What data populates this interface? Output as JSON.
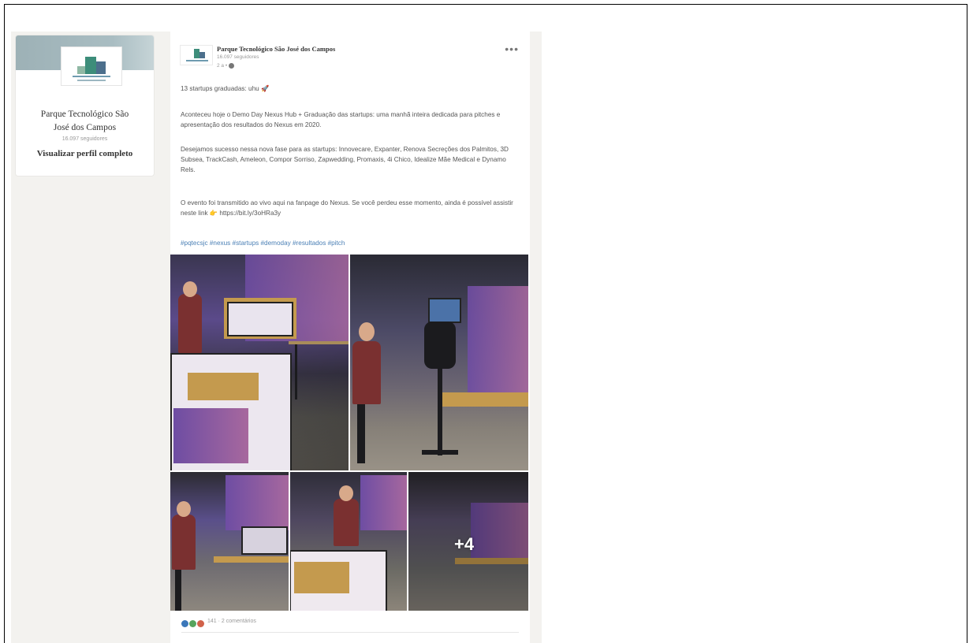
{
  "profile": {
    "name_line1": "Parque Tecnológico São",
    "name_line2": "José dos Campos",
    "followers": "16.097 seguidores",
    "view_profile": "Visualizar perfil completo"
  },
  "post": {
    "author": "Parque Tecnológico São José dos Campos",
    "followers": "16.097 seguidores",
    "time": "2 a •",
    "more": "•••",
    "line1": "13 startups graduadas: uhu 🚀",
    "para1": "Aconteceu hoje o Demo Day Nexus Hub + Graduação das startups: uma manhã inteira dedicada para pitches e apresentação dos resultados do Nexus em 2020.",
    "para2": "Desejamos sucesso nessa nova fase para as startups: Innovecare, Expanter, Renova Secreções dos Palmitos, 3D Subsea, TrackCash, Ameleon, Compor Sorriso, Zapwedding, Promaxis, 4i Chico, Idealize Mãe Medical e Dynamo Rels.",
    "para3": "O evento foi transmitido ao vivo aqui na fanpage do Nexus. Se você perdeu esse momento, ainda é possível assistir neste link 👉 https://bit.ly/3oHRa3y",
    "hashtags": "#pqtecsjc #nexus #startups #demoday #resultados #pitch",
    "more_photos": "+4",
    "reactions_text": "141 · 2 comentários"
  },
  "colors": {
    "feed_background": "#f3f2ef",
    "link": "#4a7fb5",
    "reaction_like": "#3b77b9",
    "reaction_celebrate": "#56a35c",
    "reaction_love": "#d1624a"
  }
}
